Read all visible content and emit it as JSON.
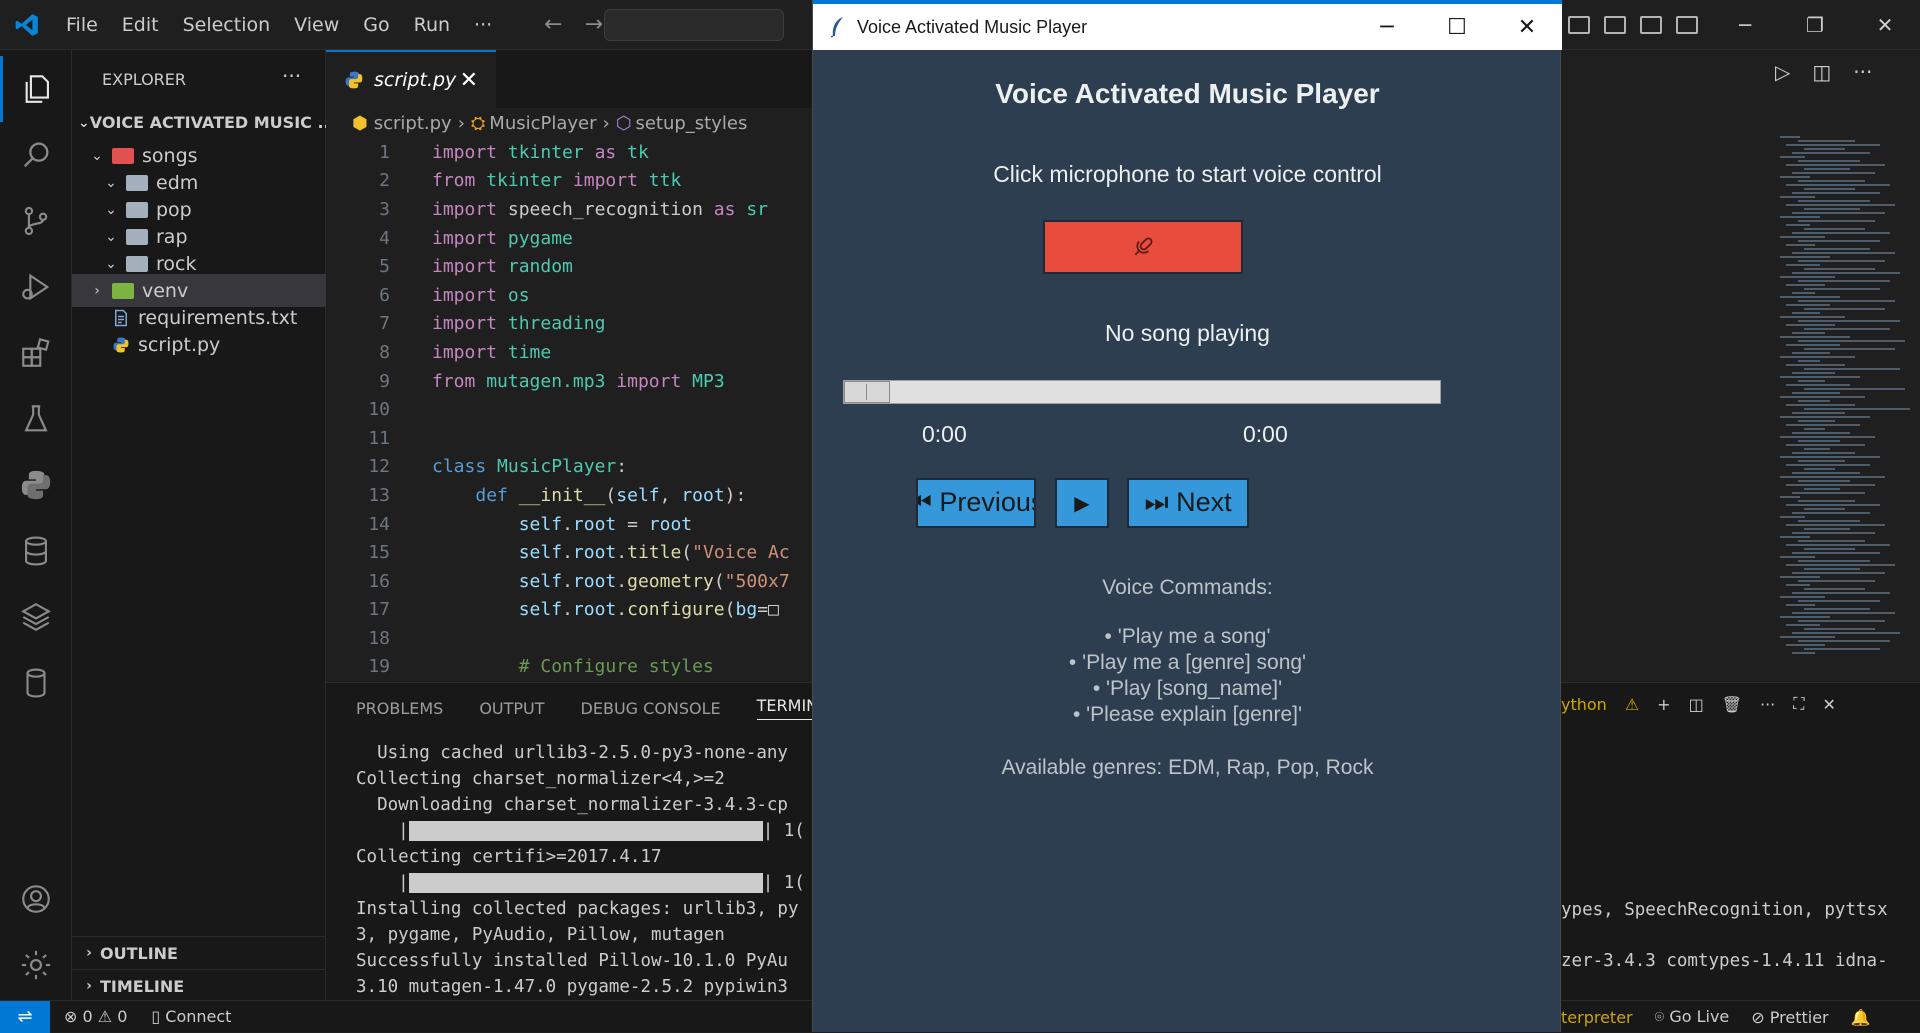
{
  "menu": [
    "File",
    "Edit",
    "Selection",
    "View",
    "Go",
    "Run",
    "···"
  ],
  "sidebar": {
    "title": "EXPLORER",
    "root": "VOICE ACTIVATED MUSIC ...",
    "items": [
      {
        "label": "songs",
        "type": "folder-red",
        "depth": 1,
        "chev": "⌄"
      },
      {
        "label": "edm",
        "type": "folder",
        "depth": 2,
        "chev": "⌄"
      },
      {
        "label": "pop",
        "type": "folder",
        "depth": 2,
        "chev": "⌄"
      },
      {
        "label": "rap",
        "type": "folder",
        "depth": 2,
        "chev": "⌄"
      },
      {
        "label": "rock",
        "type": "folder",
        "depth": 2,
        "chev": "⌄"
      },
      {
        "label": "venv",
        "type": "folder-green",
        "depth": 1,
        "chev": "›"
      },
      {
        "label": "requirements.txt",
        "type": "file-txt",
        "depth": 1,
        "chev": ""
      },
      {
        "label": "script.py",
        "type": "file-py",
        "depth": 1,
        "chev": ""
      }
    ],
    "outline": "OUTLINE",
    "timeline": "TIMELINE"
  },
  "editor": {
    "tab": "script.py",
    "breadcrumb": {
      "file": "script.py",
      "cls": "MusicPlayer",
      "method": "setup_styles"
    }
  },
  "code": [
    {
      "n": "1",
      "html": "<span class='kw'>import</span> <span class='cls'>tkinter</span> <span class='kw'>as</span> <span class='cls'>tk</span>"
    },
    {
      "n": "2",
      "html": "<span class='kw'>from</span> <span class='cls'>tkinter</span> <span class='kw'>import</span> <span class='cls'>ttk</span>"
    },
    {
      "n": "3",
      "html": "<span class='kw'>import</span> speech_recognition <span class='kw'>as</span> <span class='cls'>sr</span>"
    },
    {
      "n": "4",
      "html": "<span class='kw'>import</span> <span class='cls'>pygame</span>"
    },
    {
      "n": "5",
      "html": "<span class='kw'>import</span> <span class='cls'>random</span>"
    },
    {
      "n": "6",
      "html": "<span class='kw'>import</span> <span class='cls'>os</span>"
    },
    {
      "n": "7",
      "html": "<span class='kw'>import</span> <span class='cls'>threading</span>"
    },
    {
      "n": "8",
      "html": "<span class='kw'>import</span> <span class='cls'>time</span>"
    },
    {
      "n": "9",
      "html": "<span class='kw'>from</span> <span class='cls'>mutagen.mp3</span> <span class='kw'>import</span> <span class='cls'>MP3</span>"
    },
    {
      "n": "10",
      "html": ""
    },
    {
      "n": "11",
      "html": ""
    },
    {
      "n": "12",
      "html": "<span class='kb'>class</span> <span class='cls'>MusicPlayer</span>:"
    },
    {
      "n": "13",
      "html": "    <span class='kb'>def</span> <span class='fn'>__init__</span>(<span class='var'>self</span>, <span class='var'>root</span>):"
    },
    {
      "n": "14",
      "html": "        <span class='var'>self</span>.<span class='var'>root</span> = <span class='var'>root</span>"
    },
    {
      "n": "15",
      "html": "        <span class='var'>self</span>.<span class='var'>root</span>.<span class='fn'>title</span>(<span class='str'>\"Voice Ac</span>"
    },
    {
      "n": "16",
      "html": "        <span class='var'>self</span>.<span class='var'>root</span>.<span class='fn'>geometry</span>(<span class='str'>\"500x7</span>"
    },
    {
      "n": "17",
      "html": "        <span class='var'>self</span>.<span class='var'>root</span>.<span class='fn'>configure</span>(<span class='var'>bg</span>=□"
    },
    {
      "n": "18",
      "html": ""
    },
    {
      "n": "19",
      "html": "        <span class='cmt'># Configure styles</span>"
    }
  ],
  "panel": {
    "tabs": [
      "PROBLEMS",
      "OUTPUT",
      "DEBUG CONSOLE",
      "TERMINAL"
    ],
    "lines": [
      "  Using cached urllib3-2.5.0-py3-none-any",
      "Collecting charset_normalizer<4,>=2",
      "  Downloading charset_normalizer-3.4.3-cp",
      "BAR1",
      "Collecting certifi>=2017.4.17",
      "BAR2",
      "Installing collected packages: urllib3, py",
      "3, pygame, PyAudio, Pillow, mutagen",
      "Successfully installed Pillow-10.1.0 PyAu",
      "3.10 mutagen-1.47.0 pygame-2.5.2 pypiwin3"
    ],
    "bar_suffix": "1("
  },
  "right_panel": {
    "label": "ython",
    "lines": [
      "ypes, SpeechRecognition, pyttsx",
      "zer-3.4.3 comtypes-1.4.11 idna-"
    ]
  },
  "status": {
    "errors": "0",
    "warnings": "0",
    "connect": "Connect",
    "interpreter": "terpreter",
    "golive": "Go Live",
    "prettier": "Prettier"
  },
  "player": {
    "window_title": "Voice Activated Music Player",
    "heading": "Voice Activated Music Player",
    "instruction": "Click microphone to start voice control",
    "now_playing": "No song playing",
    "time_current": "0:00",
    "time_total": "0:00",
    "progress": 0,
    "prev_label": "⏮ Previous",
    "play_label": "▶",
    "next_label": "⏭ Next",
    "commands_title": "Voice Commands:",
    "commands": [
      "• 'Play me a song'",
      "• 'Play me a [genre] song'",
      "• 'Play [song_name]'",
      "• 'Please explain [genre]'"
    ],
    "genres": "Available genres: EDM, Rap, Pop, Rock"
  }
}
